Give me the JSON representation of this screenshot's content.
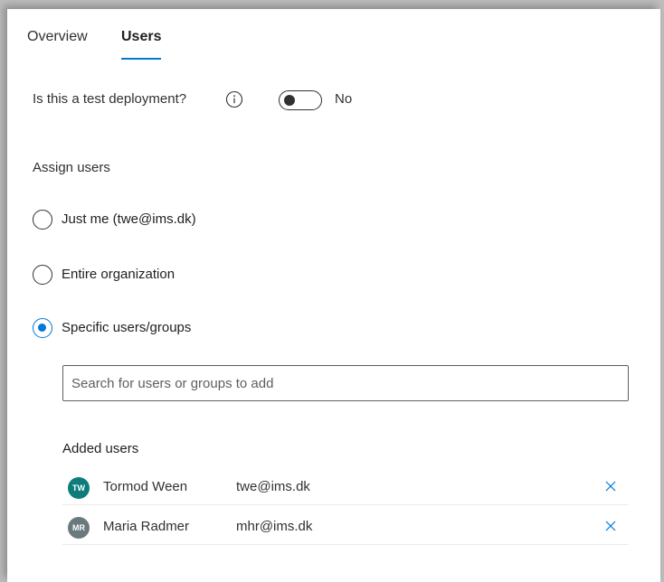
{
  "tabs": [
    {
      "label": "Overview",
      "active": false
    },
    {
      "label": "Users",
      "active": true
    }
  ],
  "test_deployment": {
    "label": "Is this a test deployment?",
    "toggle_on": false,
    "toggle_text": "No"
  },
  "assign": {
    "label": "Assign users",
    "options": [
      {
        "label": "Just me (twe@ims.dk)",
        "selected": false
      },
      {
        "label": "Entire organization",
        "selected": false
      },
      {
        "label": "Specific users/groups",
        "selected": true
      }
    ]
  },
  "search": {
    "placeholder": "Search for users or groups to add",
    "value": ""
  },
  "added_users": {
    "title": "Added users",
    "users": [
      {
        "initials": "TW",
        "name": "Tormod Ween",
        "email": "twe@ims.dk",
        "avatar_color": "#0e7c7b"
      },
      {
        "initials": "MR",
        "name": "Maria Radmer",
        "email": "mhr@ims.dk",
        "avatar_color": "#69797e"
      }
    ]
  },
  "colors": {
    "accent": "#0078d4",
    "text": "#323130"
  }
}
